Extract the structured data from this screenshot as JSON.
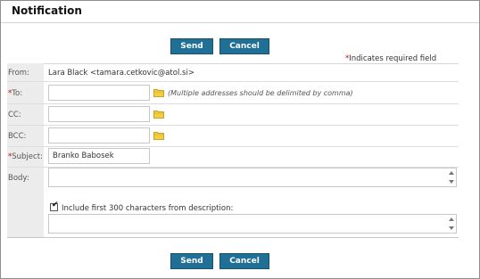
{
  "dialog": {
    "title": "Notification"
  },
  "buttons": {
    "send_label": "Send",
    "cancel_label": "Cancel",
    "color": "#1f6f96"
  },
  "required_note": {
    "star": "*",
    "text": "Indicates required field"
  },
  "form": {
    "from": {
      "label": "From:",
      "value": "Lara Black <tamara.cetkovic@atol.si>"
    },
    "to": {
      "star": "*",
      "label": "To:",
      "value": "",
      "note": "(Multiple addresses should be delimited by comma)"
    },
    "cc": {
      "label": "CC:",
      "value": ""
    },
    "bcc": {
      "label": "BCC:",
      "value": ""
    },
    "subject": {
      "star": "*",
      "label": "Subject:",
      "value": "Branko Babosek"
    },
    "body": {
      "label": "Body:",
      "value": ""
    },
    "include_description": {
      "label": "Include first 300 characters from description:",
      "checked": true,
      "value": ""
    }
  },
  "icons": {
    "address_book": "folder-icon"
  }
}
